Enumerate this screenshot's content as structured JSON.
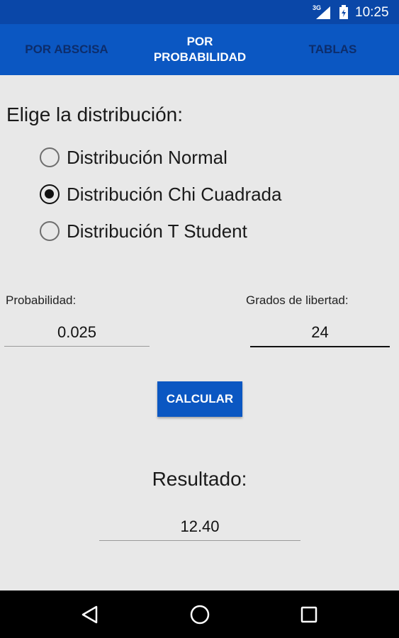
{
  "status_bar": {
    "network": "3G",
    "time": "10:25"
  },
  "tabs": [
    {
      "label": "POR ABSCISA",
      "active": false
    },
    {
      "label": "POR PROBABILIDAD",
      "active": true
    },
    {
      "label": "TABLAS",
      "active": false
    }
  ],
  "prompt": "Elige la distribución:",
  "distributions": [
    {
      "label": "Distribución Normal",
      "selected": false
    },
    {
      "label": "Distribución Chi Cuadrada",
      "selected": true
    },
    {
      "label": "Distribución T Student",
      "selected": false
    }
  ],
  "probability": {
    "label": "Probabilidad:",
    "value": "0.025"
  },
  "degrees_of_freedom": {
    "label": "Grados de libertad:",
    "value": "24"
  },
  "calculate_button": "CALCULAR",
  "result": {
    "label": "Resultado:",
    "value": "12.40"
  },
  "colors": {
    "status_bar": "#0a47a8",
    "tab_bar": "#0b57c2",
    "tab_inactive_text": "#0d2d6b",
    "background": "#e8e8e8"
  },
  "nav_icons": [
    "back-icon",
    "home-icon",
    "recents-icon"
  ]
}
